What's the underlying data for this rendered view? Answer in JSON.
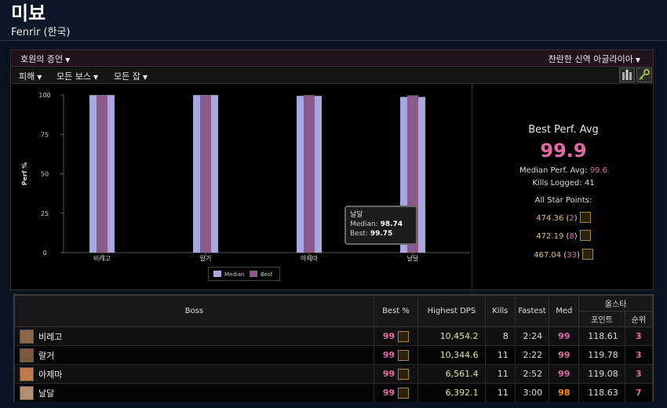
{
  "header": {
    "character_name": "미뵤",
    "server": "Fenrir (한국)"
  },
  "toolbar": {
    "zone_left": "호원의 증언",
    "zone_right": "찬란한 신역 아글라이아",
    "filter_1": "피해",
    "filter_2": "모든 보스",
    "filter_3": "모든 잡",
    "icon_1": "party-icon",
    "icon_2": "key-icon"
  },
  "stats": {
    "title": "Best Perf. Avg",
    "value": "99.9",
    "median_label": "Median Perf. Avg:",
    "median_value": "99.6",
    "kills_label": "Kills Logged:",
    "kills_value": "41",
    "allstar_label": "All Star Points:",
    "allstar": [
      {
        "points": "474.36",
        "rank": "2",
        "icon": "star-icon-1"
      },
      {
        "points": "472.19",
        "rank": "8",
        "icon": "star-icon-2"
      },
      {
        "points": "467.04",
        "rank": "33",
        "icon": "star-icon-3"
      }
    ]
  },
  "tooltip": {
    "title": "날달",
    "median_label": "Median:",
    "median_value": "98.74",
    "best_label": "Best:",
    "best_value": "99.75"
  },
  "chart_data": {
    "type": "bar",
    "categories": [
      "비레고",
      "랄거",
      "아제마",
      "날달"
    ],
    "series": [
      {
        "name": "Median",
        "values": [
          99.9,
          99.9,
          99.4,
          98.74
        ],
        "color": "#a8a8e0"
      },
      {
        "name": "Best",
        "values": [
          99.9,
          99.9,
          99.9,
          99.75
        ],
        "color": "#8a5a8a"
      }
    ],
    "ylabel": "Perf %",
    "ylim": [
      0,
      100
    ],
    "yticks": [
      "0",
      "25",
      "50",
      "75",
      "100"
    ],
    "legend_position": "bottom",
    "grid": false
  },
  "table": {
    "headers": {
      "boss": "Boss",
      "best": "Best %",
      "dps": "Highest DPS",
      "kills": "Kills",
      "fastest": "Fastest",
      "med": "Med",
      "allstar": "올스타",
      "points": "포인트",
      "rank": "순위"
    },
    "rows": [
      {
        "boss": "비레고",
        "best": "99",
        "dps": "10,454.2",
        "kills": "8",
        "fastest": "2:24",
        "med": "99",
        "points": "118.61",
        "rank": "3",
        "icon_color": "#8a6a4a"
      },
      {
        "boss": "랄거",
        "best": "99",
        "dps": "10,344.6",
        "kills": "11",
        "fastest": "2:22",
        "med": "99",
        "points": "119.78",
        "rank": "3",
        "icon_color": "#7a5a3a"
      },
      {
        "boss": "아제마",
        "best": "99",
        "dps": "6,561.4",
        "kills": "11",
        "fastest": "2:52",
        "med": "99",
        "points": "119.08",
        "rank": "3",
        "icon_color": "#c07a4a"
      },
      {
        "boss": "날달",
        "best": "99",
        "dps": "6,392.1",
        "kills": "11",
        "fastest": "3:00",
        "med": "98",
        "points": "118.63",
        "rank": "7",
        "icon_color": "#b09070"
      }
    ]
  }
}
